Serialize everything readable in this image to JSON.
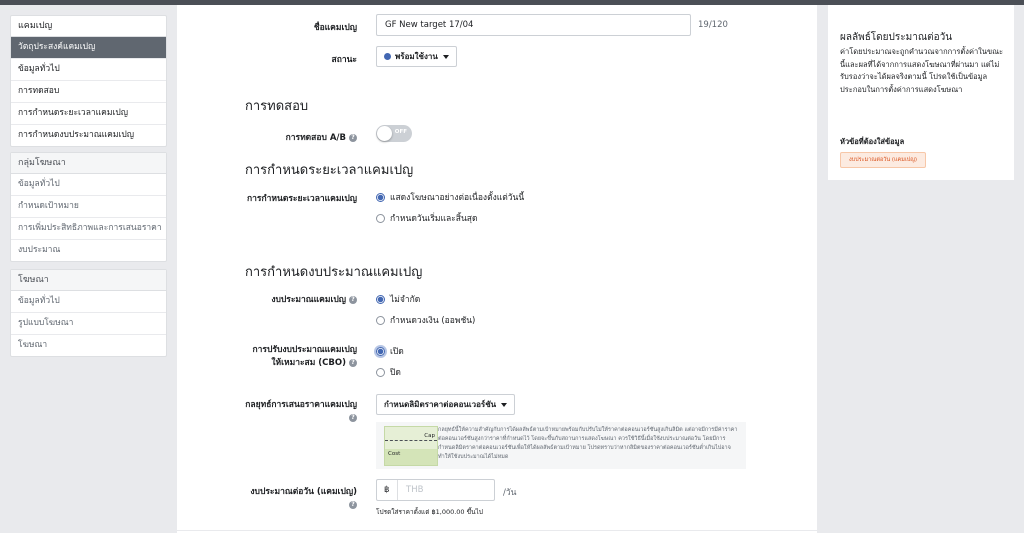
{
  "left_nav": {
    "campaign_group": {
      "header": "แคมเปญ",
      "items": [
        "วัตถุประสงค์แคมเปญ",
        "ข้อมูลทั่วไป",
        "การทดสอบ",
        "การกำหนดระยะเวลาแคมเปญ",
        "การกำหนดงบประมาณแคมเปญ"
      ]
    },
    "adset_group": {
      "header": "กลุ่มโฆษณา",
      "items": [
        "ข้อมูลทั่วไป",
        "กำหนดเป้าหมาย",
        "การเพิ่มประสิทธิภาพและการเสนอราคา",
        "งบประมาณ"
      ]
    },
    "ad_group": {
      "header": "โฆษณา",
      "items": [
        "ข้อมูลทั่วไป",
        "รูปแบบโฆษณา",
        "โฆษณา"
      ]
    }
  },
  "form": {
    "campaign_name_label": "ชื่อแคมเปญ",
    "campaign_name_value": "GF New target 17/04",
    "campaign_name_count": "19/120",
    "status_label": "สถานะ",
    "status_value": "พร้อมใช้งาน",
    "status_color": "#4267b2",
    "testing_heading": "การทดสอบ",
    "ab_test_label": "การทดสอบ A/B",
    "ab_test_toggle": "OFF",
    "schedule_heading": "การกำหนดระยะเวลาแคมเปญ",
    "schedule_label": "การกำหนดระยะเวลาแคมเปญ",
    "schedule_option_1": "แสดงโฆษณาอย่างต่อเนื่องตั้งแต่วันนี้",
    "schedule_option_2": "กำหนดวันเริ่มและสิ้นสุด",
    "budget_heading": "การกำหนดงบประมาณแคมเปญ",
    "budget_label": "งบประมาณแคมเปญ",
    "budget_option_1": "ไม่จำกัด",
    "budget_option_2": "กำหนดวงเงิน (ออพชัน)",
    "cbo_label_line1": "การปรับงบประมาณแคมเปญ",
    "cbo_label_line2": "ให้เหมาะสม (CBO)",
    "cbo_option_1": "เปิด",
    "cbo_option_2": "ปิด",
    "bid_strategy_label": "กลยุทธ์การเสนอราคาแคมเปญ",
    "bid_strategy_value": "กำหนดลิมิตราคาต่อคอนเวอร์ชัน",
    "bid_info_text": "กลยุทธ์นี้ให้ความสำคัญกับการได้ผลลัพธ์ตามเป้าหมายพร้อมกับปรับไม่ให้ราคาต่อคอนเวอร์ชันสูงเกินลิมิต แต่อาจมีการมีค่าราคาต่อคอนเวอร์ชันสูงกว่าราคาที่กำหนดไว้ โดยจะขึ้นกับสถานการแสดงโฆษณา ควรใช้วิธีนี้เมื่อใช้งบประมาณต่อวัน โดยมีการกำหนดลิมิตราคาต่อคอนเวอร์ชันเพื่อให้ได้ผลลัพธ์ตามเป้าหมาย โปรดทราบว่าหากลิมิตของราคาต่อคอนเวอร์ชันต่ำเกินไปอาจทำให้ใช้งบประมาณได้ไม่หมด",
    "chart_cost_label": "Cost",
    "chart_cap_label": "Cap",
    "daily_budget_label": "งบประมาณต่อวัน (แคมเปญ)",
    "currency_symbol": "฿",
    "currency_placeholder": "THB",
    "per_day": "/วัน",
    "min_budget_note": "โปรดใส่ราคาตั้งแต่ ฿1,000.00 ขึ้นไป"
  },
  "right_panel": {
    "title": "ผลลัพธ์โดยประมาณต่อวัน",
    "description": "ค่าโดยประมาณจะถูกคำนวณจากการตั้งค่าในขณะนี้และผลที่ได้จากการแสดงโฆษณาที่ผ่านมา แต่ไม่รับรองว่าจะได้ผลจริงตามนี้ โปรดใช้เป็นข้อมูลประกอบในการตั้งค่าการแสดงโฆษณา",
    "required_heading": "หัวข้อที่ต้องใส่ข้อมูล",
    "required_tag": "งบประมาณต่อวัน (แคมเปญ)"
  }
}
